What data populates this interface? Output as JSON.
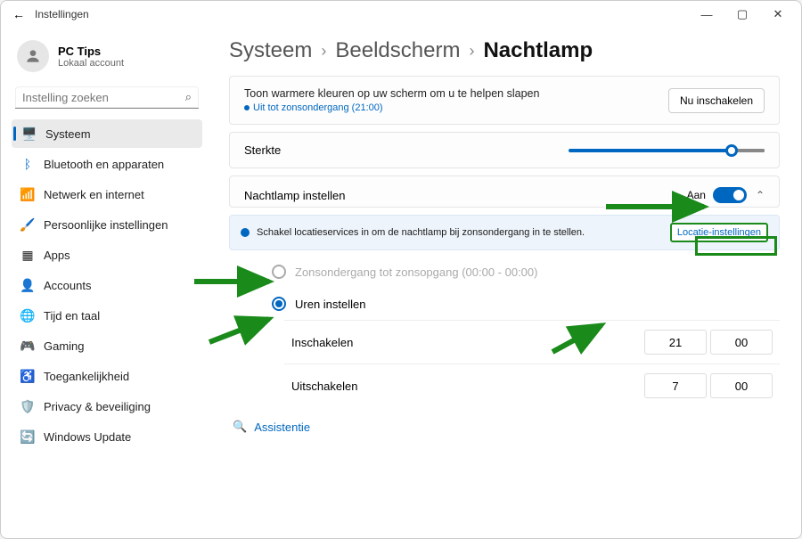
{
  "titlebar": {
    "app_title": "Instellingen"
  },
  "account": {
    "name": "PC Tips",
    "sub": "Lokaal account"
  },
  "search": {
    "placeholder": "Instelling zoeken"
  },
  "sidebar": {
    "items": [
      {
        "label": "Systeem"
      },
      {
        "label": "Bluetooth en apparaten"
      },
      {
        "label": "Netwerk en internet"
      },
      {
        "label": "Persoonlijke instellingen"
      },
      {
        "label": "Apps"
      },
      {
        "label": "Accounts"
      },
      {
        "label": "Tijd en taal"
      },
      {
        "label": "Gaming"
      },
      {
        "label": "Toegankelijkheid"
      },
      {
        "label": "Privacy & beveiliging"
      },
      {
        "label": "Windows Update"
      }
    ]
  },
  "breadcrumb": {
    "a": "Systeem",
    "b": "Beeldscherm",
    "c": "Nachtlamp"
  },
  "top_card": {
    "desc": "Toon warmere kleuren op uw scherm om u te helpen slapen",
    "status": "Uit tot zonsondergang (21:00)",
    "button": "Nu inschakelen"
  },
  "strength": {
    "label": "Sterkte"
  },
  "schedule": {
    "label": "Nachtlamp instellen",
    "state": "Aan"
  },
  "info": {
    "text": "Schakel locatieservices in om de nachtlamp bij zonsondergang in te stellen.",
    "link": "Locatie-instellingen"
  },
  "radio1": {
    "label": "Zonsondergang tot zonsopgang (00:00 - 00:00)"
  },
  "radio2": {
    "label": "Uren instellen"
  },
  "turn_on": {
    "label": "Inschakelen",
    "h": "21",
    "m": "00"
  },
  "turn_off": {
    "label": "Uitschakelen",
    "h": "7",
    "m": "00"
  },
  "assist": {
    "label": "Assistentie"
  }
}
